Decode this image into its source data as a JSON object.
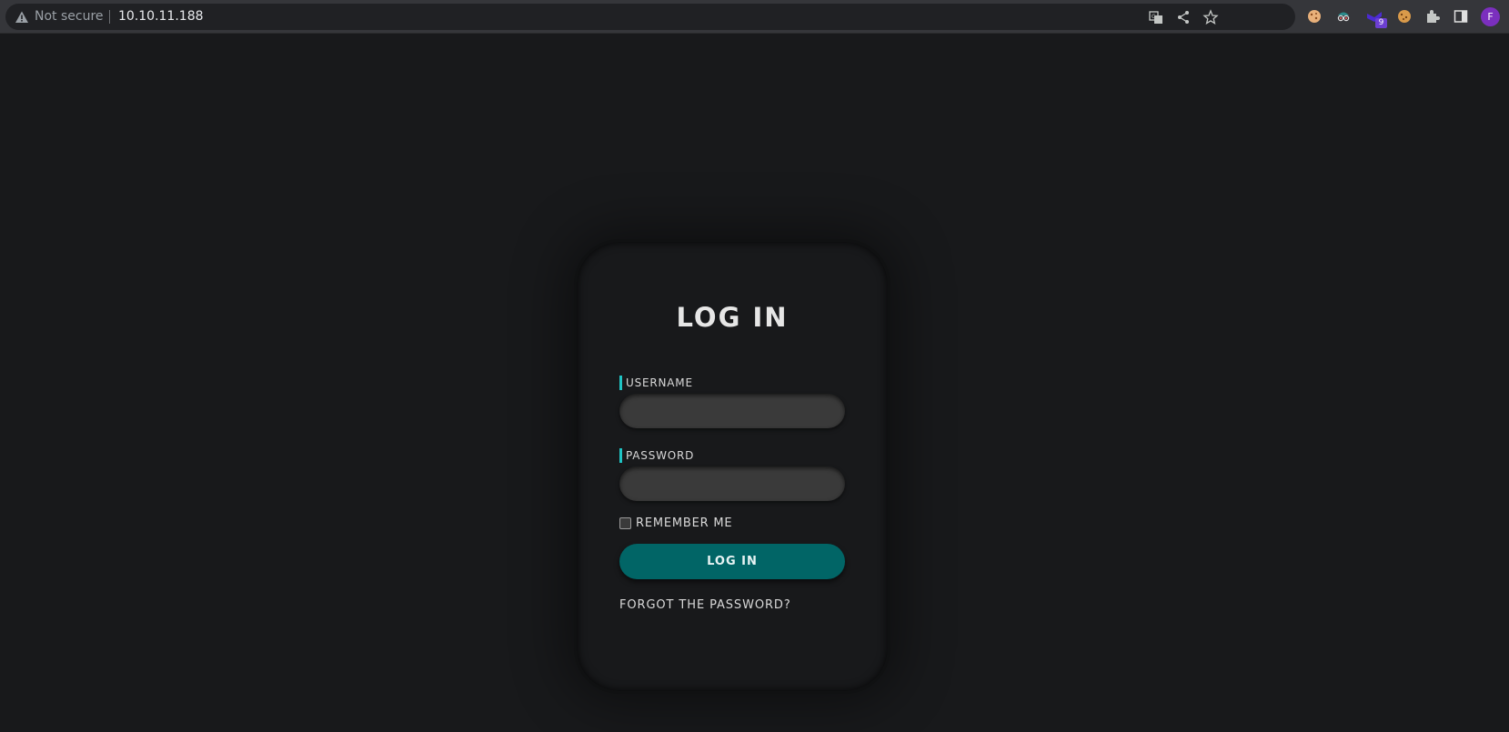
{
  "browser": {
    "security_text": "Not secure",
    "url": "10.10.11.188",
    "extension_badge": "9",
    "profile_initial": "F"
  },
  "login": {
    "title": "LOG IN",
    "username_label": "USERNAME",
    "username_value": "",
    "password_label": "PASSWORD",
    "password_value": "",
    "remember_label": "REMEMBER ME",
    "remember_checked": false,
    "submit_label": "LOG IN",
    "forgot_label": "FORGOT THE PASSWORD?"
  },
  "colors": {
    "page_bg": "#18191b",
    "accent": "#1fc4c4",
    "button_bg": "#016566",
    "input_bg": "#3a3a3a"
  }
}
